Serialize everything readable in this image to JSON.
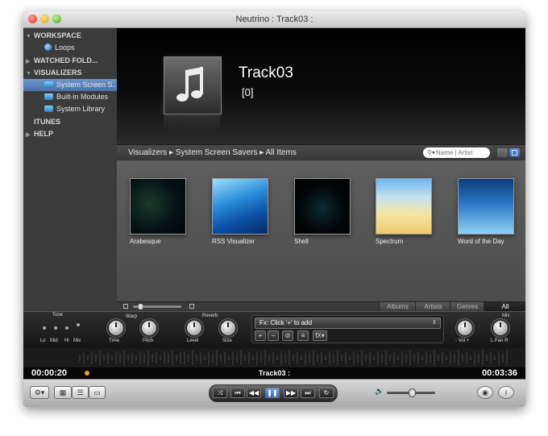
{
  "window": {
    "title": "Neutrino : Track03 :"
  },
  "sidebar": {
    "sections": [
      {
        "label": "WORKSPACE",
        "expanded": true,
        "items": [
          {
            "label": "Loops",
            "icon": "loops-icon"
          }
        ]
      },
      {
        "label": "WATCHED FOLD...",
        "expanded": false,
        "items": []
      },
      {
        "label": "VISUALIZERS",
        "expanded": true,
        "items": [
          {
            "label": "System Screen S...",
            "icon": "screensaver-icon",
            "selected": true
          },
          {
            "label": "Built-in Modules",
            "icon": "module-icon",
            "selected": false
          },
          {
            "label": "System Library",
            "icon": "library-icon",
            "selected": false
          }
        ]
      },
      {
        "label": "ITUNES",
        "expanded": null,
        "items": []
      },
      {
        "label": "HELP",
        "expanded": false,
        "items": []
      }
    ]
  },
  "now_playing": {
    "title": "Track03",
    "subtitle": "[0]",
    "art_icon": "music-note-icon"
  },
  "breadcrumb": {
    "text": "Visualizers ▸ System Screen Savers ▸ All Items"
  },
  "search": {
    "placeholder": "Name | Artist"
  },
  "gallery": {
    "items": [
      {
        "label": "Arabesque"
      },
      {
        "label": "RSS Visualizer"
      },
      {
        "label": "Shell"
      },
      {
        "label": "Spectrum"
      },
      {
        "label": "Word of the Day"
      }
    ]
  },
  "filter_tabs": [
    {
      "label": "Albums",
      "selected": false
    },
    {
      "label": "Artists",
      "selected": false
    },
    {
      "label": "Genres",
      "selected": false
    },
    {
      "label": "All",
      "selected": true
    }
  ],
  "mixer": {
    "tone_label": "Tone",
    "eq_labels": [
      "Lo",
      "Mid",
      "Hi",
      "Mix"
    ],
    "warp_label": "Warp",
    "time_label": "Time",
    "pitch_label": "Pitch",
    "reverb_label": "Reverb",
    "level_label": "Level",
    "size_label": "Size",
    "fx_select": "Fx: Click '+' to add",
    "fx_buttons": [
      "+",
      "−",
      "⊘",
      "≡",
      "fX▾"
    ],
    "vol_label": "- Vol +",
    "mix_label": "Mix",
    "pan_label": "L Pan R"
  },
  "transport": {
    "elapsed": "00:00:20",
    "track": "Track03 :",
    "remaining": "00:03:36",
    "buttons": {
      "shuffle": "⤨",
      "prev": "⏮",
      "rewind": "◀◀",
      "play_pause": "❚❚",
      "forward": "▶▶",
      "next": "⏭",
      "repeat": "↻"
    },
    "volume_icon": "🔈"
  },
  "colors": {
    "accent": "#4a73ab",
    "playhead": "#f0a020"
  }
}
